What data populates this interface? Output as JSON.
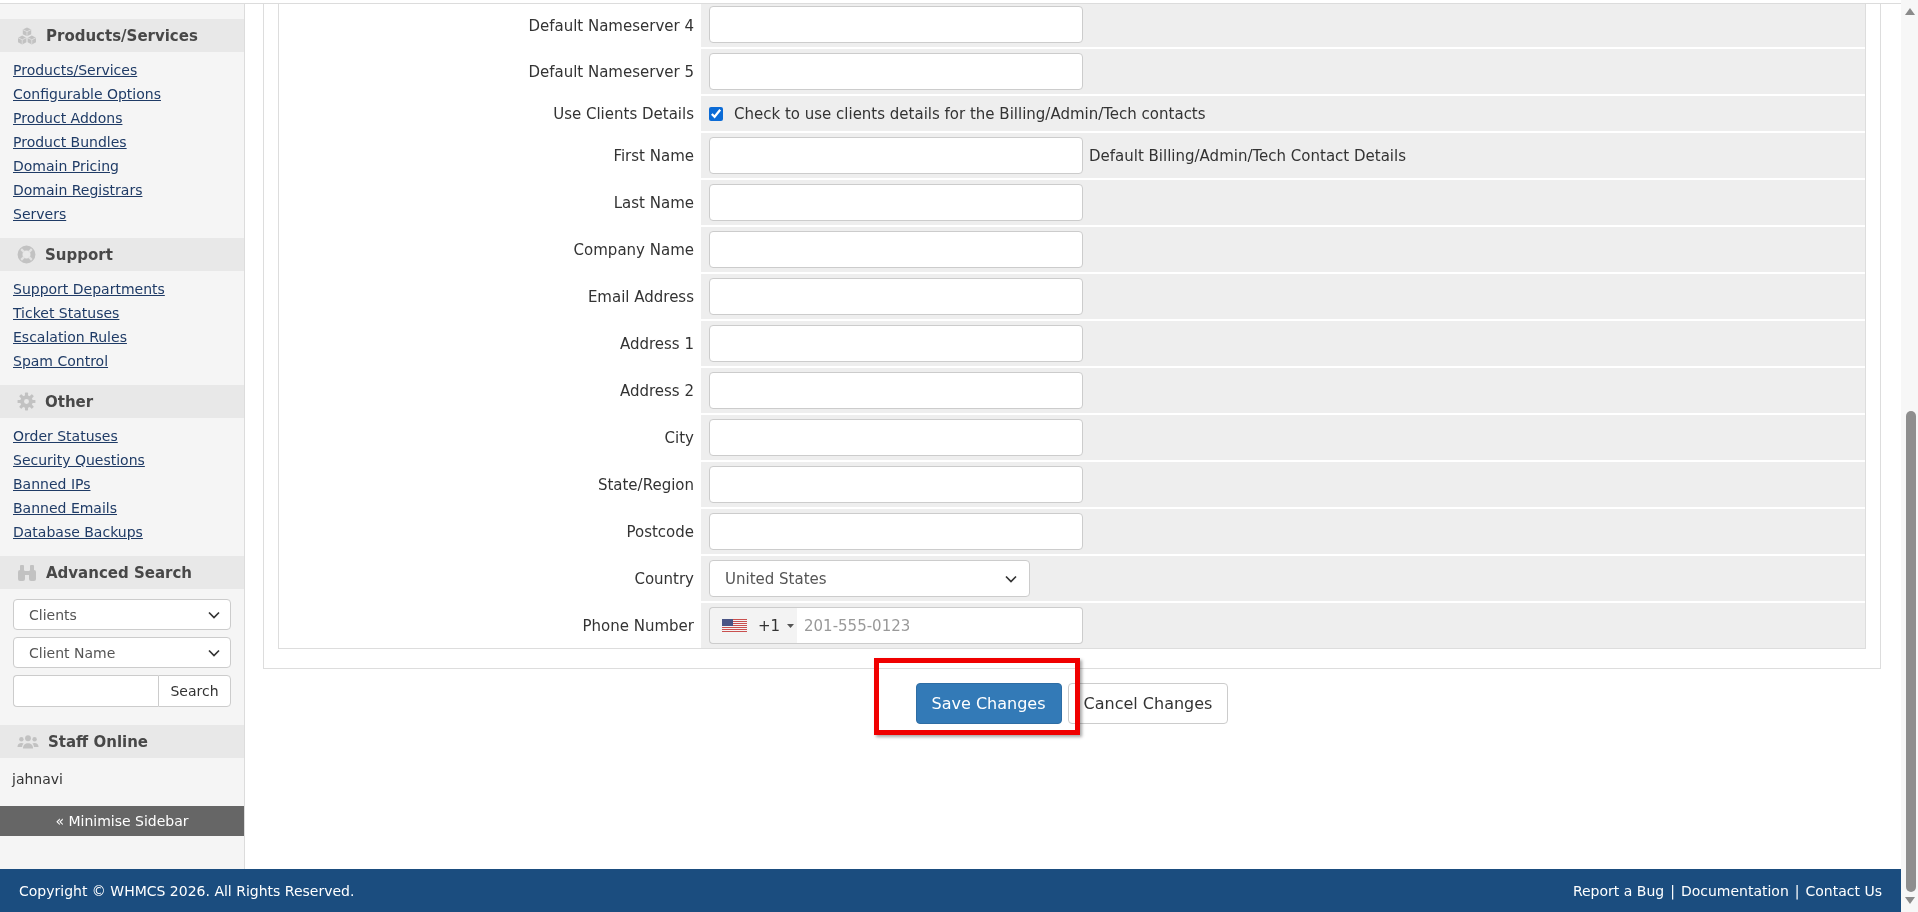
{
  "sidebar": {
    "sections": [
      {
        "kind": "links",
        "title": "Products/Services",
        "links": [
          "Products/Services",
          "Configurable Options",
          "Product Addons",
          "Product Bundles",
          "Domain Pricing",
          "Domain Registrars",
          "Servers"
        ]
      },
      {
        "kind": "links",
        "title": "Support",
        "links": [
          "Support Departments",
          "Ticket Statuses",
          "Escalation Rules",
          "Spam Control"
        ]
      },
      {
        "kind": "links",
        "title": "Other",
        "links": [
          "Order Statuses",
          "Security Questions",
          "Banned IPs",
          "Banned Emails",
          "Database Backups"
        ]
      },
      {
        "kind": "search",
        "title": "Advanced Search",
        "selects": [
          "Clients",
          "Client Name"
        ],
        "button": "Search"
      },
      {
        "kind": "staff",
        "title": "Staff Online",
        "staff": [
          "jahnavi"
        ]
      }
    ],
    "minimise_button": "« Minimise Sidebar"
  },
  "form": {
    "rows": [
      {
        "kind": "text",
        "label": "Default Nameserver 4"
      },
      {
        "kind": "text",
        "label": "Default Nameserver 5"
      },
      {
        "kind": "checkbox",
        "label": "Use Clients Details",
        "checked": true,
        "text": "Check to use clients details for the Billing/Admin/Tech contacts"
      },
      {
        "kind": "text",
        "label": "First Name",
        "note": "Default Billing/Admin/Tech Contact Details"
      },
      {
        "kind": "text",
        "label": "Last Name"
      },
      {
        "kind": "text",
        "label": "Company Name"
      },
      {
        "kind": "text",
        "label": "Email Address"
      },
      {
        "kind": "text",
        "label": "Address 1"
      },
      {
        "kind": "text",
        "label": "Address 2"
      },
      {
        "kind": "text",
        "label": "City"
      },
      {
        "kind": "text",
        "label": "State/Region"
      },
      {
        "kind": "text",
        "label": "Postcode"
      },
      {
        "kind": "select",
        "label": "Country",
        "value": "United States"
      },
      {
        "kind": "phone",
        "label": "Phone Number",
        "dial_code": "+1",
        "placeholder": "201-555-0123"
      }
    ],
    "buttons": [
      {
        "kind": "primary",
        "label": "Save Changes",
        "highlighted": true
      },
      {
        "kind": "default",
        "label": "Cancel Changes",
        "highlighted": false
      }
    ]
  },
  "footer": {
    "copyright": "Copyright © WHMCS 2026. All Rights Reserved.",
    "links": [
      {
        "text": "Report a Bug",
        "separator_after": "|"
      },
      {
        "text": "Documentation",
        "separator_after": "|"
      },
      {
        "text": "Contact Us"
      }
    ]
  }
}
